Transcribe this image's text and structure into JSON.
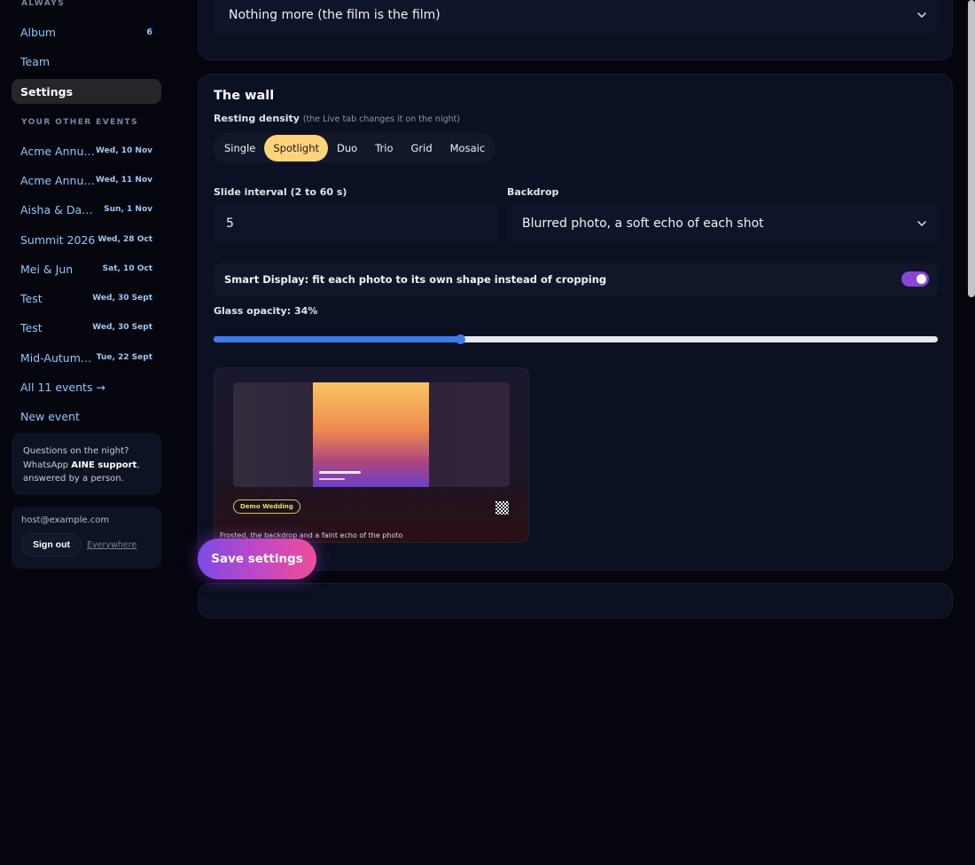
{
  "sidebar": {
    "section_always": "ALWAYS",
    "nav": [
      {
        "label": "Album",
        "count": "6"
      },
      {
        "label": "Team",
        "count": ""
      },
      {
        "label": "Settings",
        "count": ""
      }
    ],
    "section_other_events": "YOUR OTHER EVENTS",
    "events": [
      {
        "name": "Acme Annual Gala",
        "date": "Wed, 10 Nov"
      },
      {
        "name": "Acme Annual Summit",
        "date": "Wed, 11 Nov"
      },
      {
        "name": "Aisha & Daniel",
        "date": "Sun, 1 Nov"
      },
      {
        "name": "Summit 2026",
        "date": "Wed, 28 Oct"
      },
      {
        "name": "Mei & Jun",
        "date": "Sat, 10 Oct"
      },
      {
        "name": "Test",
        "date": "Wed, 30 Sept"
      },
      {
        "name": "Test",
        "date": "Wed, 30 Sept"
      },
      {
        "name": "Mid-Autumn Festival",
        "date": "Tue, 22 Sept"
      }
    ],
    "all_events_link": "All 11 events →",
    "new_event_link": "New event",
    "help": {
      "line1": "Questions on the night?",
      "prefix": "WhatsApp ",
      "brand": "AINE support",
      "suffix": ",",
      "line3": "answered by a person."
    },
    "account": {
      "email": "host@example.com",
      "signout_label": "Sign out",
      "everywhere_label": "Everywhere"
    }
  },
  "top_panel": {
    "ending_select_value": "Nothing more (the film is the film)"
  },
  "wall": {
    "title": "The wall",
    "density_label": "Resting density",
    "density_hint": "(the Live tab changes it on the night)",
    "density_options": [
      "Single",
      "Spotlight",
      "Duo",
      "Trio",
      "Grid",
      "Mosaic"
    ],
    "density_selected": "Spotlight",
    "slide_interval_label": "Slide interval (2 to 60 s)",
    "slide_interval_value": "5",
    "backdrop_label": "Backdrop",
    "backdrop_value": "Blurred photo, a soft echo of each shot",
    "smart_display_label": "Smart Display: fit each photo to its own shape instead of cropping",
    "smart_display_on": true,
    "glass_opacity_label": "Glass opacity: 34%",
    "glass_opacity_value": 0.34,
    "preview_badge": "Demo Wedding",
    "preview_caption": "Frosted, the backdrop and a faint echo of the photo"
  },
  "save_label": "Save settings",
  "colors": {
    "accent_yellow": "#ffd37a",
    "toggle_purple": "#8b44d6",
    "slider_blue": "#3f7be8",
    "link_blue": "#8ec7ff"
  }
}
